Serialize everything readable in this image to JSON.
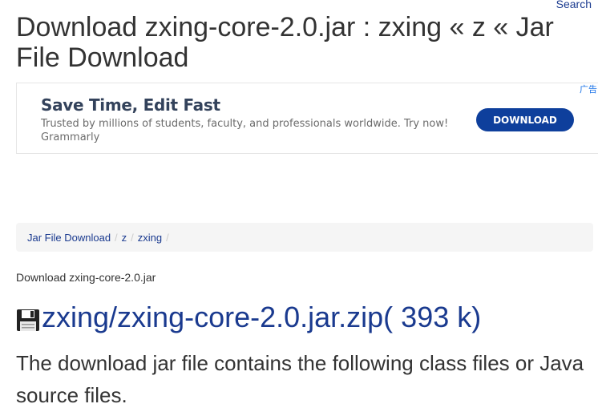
{
  "header": {
    "search_label": "Search",
    "page_title": "Download zxing-core-2.0.jar : zxing « z « Jar File Download"
  },
  "ad": {
    "headline": "Save Time, Edit Fast",
    "body": "Trusted by millions of students, faculty, and professionals worldwide. Try now!",
    "advertiser": "Grammarly",
    "button_label": "DOWNLOAD",
    "choices_label": "广告",
    "close_glyph": "✕",
    "button_color": "#0e3f9c"
  },
  "breadcrumb": {
    "items": [
      {
        "label": "Jar File Download"
      },
      {
        "label": "z"
      },
      {
        "label": "zxing"
      }
    ],
    "separator": "/"
  },
  "main": {
    "subtitle": "Download zxing-core-2.0.jar",
    "file_icon": "floppy-disk-icon",
    "file_link": "zxing/zxing-core-2.0.jar.zip( 393 k)",
    "description": "The download jar file contains the following class files or Java source files."
  },
  "colors": {
    "link": "#1a3a8f",
    "text": "#333333",
    "breadcrumb_bg": "#f5f5f5"
  }
}
